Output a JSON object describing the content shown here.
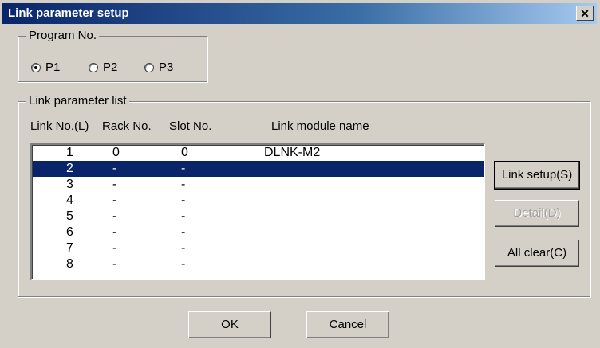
{
  "window": {
    "title": "Link parameter setup",
    "close_glyph": "✕"
  },
  "program_group": {
    "legend": "Program No.",
    "options": [
      {
        "label": "P1",
        "checked": true
      },
      {
        "label": "P2",
        "checked": false
      },
      {
        "label": "P3",
        "checked": false
      }
    ]
  },
  "list_group": {
    "legend": "Link parameter list",
    "headers": {
      "link_no": "Link No.(L)",
      "rack_no": "Rack No.",
      "slot_no": "Slot No.",
      "module": "Link module name"
    },
    "rows": [
      {
        "link": "1",
        "rack": "0",
        "slot": "0",
        "module": "DLNK-M2"
      },
      {
        "link": "2",
        "rack": "-",
        "slot": "-",
        "module": ""
      },
      {
        "link": "3",
        "rack": "-",
        "slot": "-",
        "module": ""
      },
      {
        "link": "4",
        "rack": "-",
        "slot": "-",
        "module": ""
      },
      {
        "link": "5",
        "rack": "-",
        "slot": "-",
        "module": ""
      },
      {
        "link": "6",
        "rack": "-",
        "slot": "-",
        "module": ""
      },
      {
        "link": "7",
        "rack": "-",
        "slot": "-",
        "module": ""
      },
      {
        "link": "8",
        "rack": "-",
        "slot": "-",
        "module": ""
      }
    ],
    "selected_row": 2
  },
  "side_buttons": {
    "link_setup": "Link setup(S)",
    "detail": "Detail(D)",
    "all_clear": "All clear(C)"
  },
  "footer": {
    "ok": "OK",
    "cancel": "Cancel"
  }
}
